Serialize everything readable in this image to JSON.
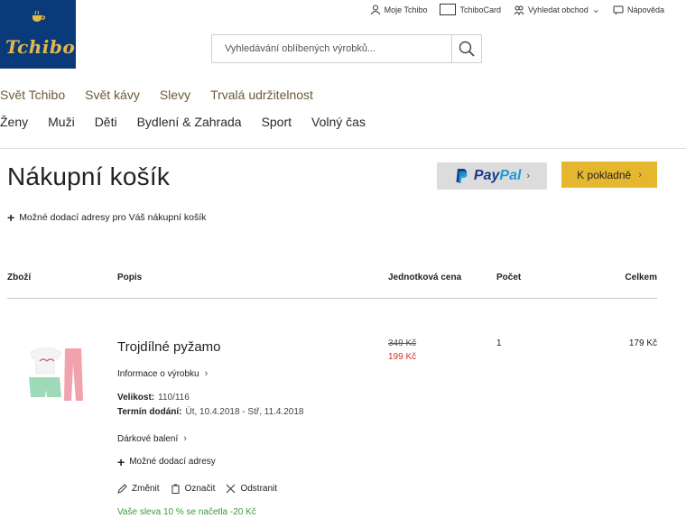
{
  "logo": {
    "text": "Tchibo"
  },
  "topbar": {
    "items": [
      {
        "label": "Moje Tchibo",
        "icon": "user-icon"
      },
      {
        "label": "TchiboCard",
        "icon": "card-icon"
      },
      {
        "label": "Vyhledat obchod",
        "icon": "store-locator-icon"
      },
      {
        "label": "Nápověda",
        "icon": "help-chat-icon"
      }
    ]
  },
  "search": {
    "placeholder": "Vyhledávání oblíbených výrobků..."
  },
  "nav_primary": [
    "Svět Tchibo",
    "Svět kávy",
    "Slevy",
    "Trvalá udržitelnost"
  ],
  "nav_secondary": [
    "Ženy",
    "Muži",
    "Děti",
    "Bydlení & Zahrada",
    "Sport",
    "Volný čas"
  ],
  "page": {
    "title": "Nákupní košík",
    "paypal_label_a": "Pay",
    "paypal_label_b": "Pal",
    "checkout_label": "K pokladně",
    "delivery_addresses": "Možné dodací adresy pro Váš nákupní košík"
  },
  "table": {
    "headers": {
      "item": "Zboží",
      "desc": "Popis",
      "unit_price": "Jednotková cena",
      "qty": "Počet",
      "total": "Celkem"
    }
  },
  "item": {
    "title": "Trojdílné pyžamo",
    "info_link": "Informace o výrobku",
    "size_label": "Velikost:",
    "size_value": "110/116",
    "delivery_label": "Termín dodání:",
    "delivery_value": "Út, 10.4.2018 - Stř, 11.4.2018",
    "gift_wrap": "Dárkové balení",
    "delivery_addresses": "Možné dodací adresy",
    "action_change": "Změnit",
    "action_mark": "Označit",
    "action_remove": "Odstranit",
    "discount_note": "Vaše sleva 10 % se načetla  -20 Kč",
    "price_old": "349 Kč",
    "price_new": "199 Kč",
    "quantity": "1",
    "total": "179 Kč"
  },
  "colors": {
    "brand_blue": "#0b3a7a",
    "checkout_yellow": "#e5b72f",
    "discount_green": "#3d9a3d",
    "sale_red": "#d2302a"
  }
}
